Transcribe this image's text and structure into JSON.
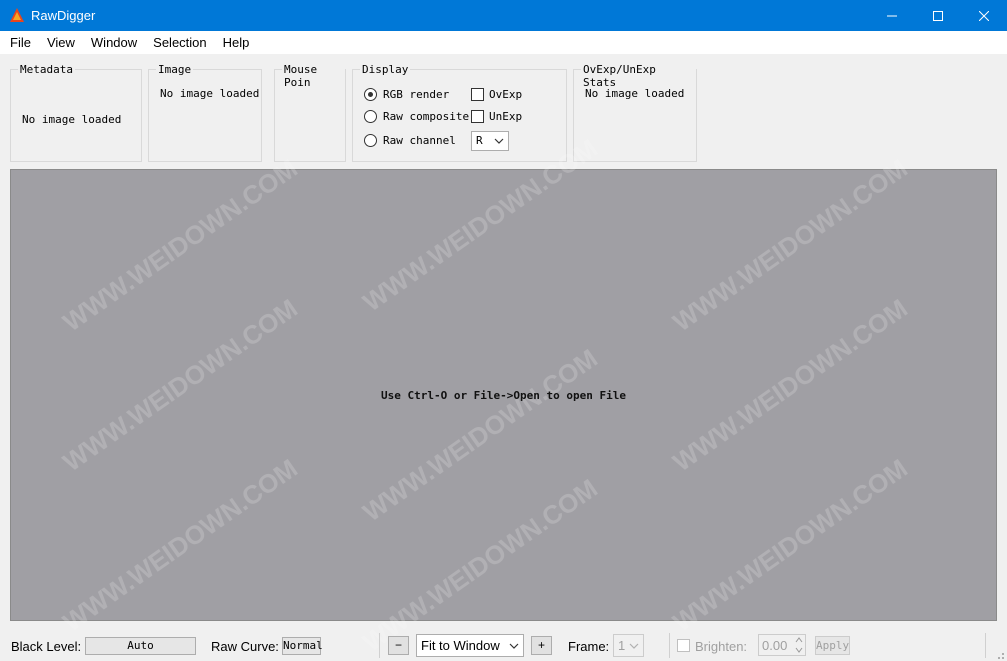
{
  "window": {
    "title": "RawDigger",
    "min_icon": "minimize-icon",
    "max_icon": "maximize-icon",
    "close_icon": "close-icon"
  },
  "menu": [
    {
      "label": "File"
    },
    {
      "label": "View"
    },
    {
      "label": "Window"
    },
    {
      "label": "Selection"
    },
    {
      "label": "Help"
    }
  ],
  "panels": {
    "metadata": {
      "title": "Metadata",
      "text": "No image loaded"
    },
    "image": {
      "title": "Image",
      "text": "No image loaded"
    },
    "mouse": {
      "title": "Mouse Poin"
    },
    "display": {
      "title": "Display",
      "rgb_render": "RGB render",
      "raw_composite": "Raw composite",
      "raw_channel": "Raw channel",
      "ovexp": "OvExp",
      "unexp": "UnExp",
      "channel_value": "R"
    },
    "stats": {
      "title": "OvExp/UnExp Stats",
      "text": "No image loaded"
    }
  },
  "canvas": {
    "message": "Use Ctrl-O or File->Open to open File",
    "background": "#a09fa4",
    "watermark": "WWW.WEIDOWN.COM"
  },
  "bottom": {
    "black_level_label": "Black Level:",
    "black_level_value": "Auto",
    "raw_curve_label": "Raw Curve:",
    "raw_curve_value": "Normal",
    "zoom_minus": "−",
    "zoom_value": "Fit to Window",
    "zoom_plus": "+",
    "frame_label": "Frame:",
    "frame_value": "1",
    "brighten_label": "Brighten:",
    "brighten_value": "0.00",
    "apply_label": "Apply"
  },
  "colors": {
    "titlebar": "#0078d7",
    "canvas": "#a09fa4"
  }
}
